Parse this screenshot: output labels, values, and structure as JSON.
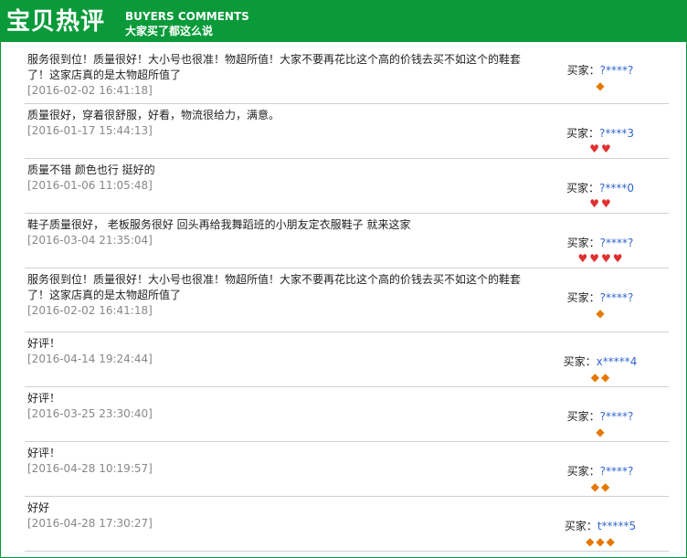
{
  "header": {
    "title": "宝贝热评",
    "subtitle_en": "BUYERS COMMENTS",
    "subtitle_cn": "大家买了都这么说"
  },
  "buyer_label": "买家：",
  "reviews": [
    {
      "text": "服务很到位！质量很好！大小号也很准！物超所值！大家不要再花比这个高的价钱去买不如这个的鞋套了！这家店真的是太物超所值了",
      "time": "[2016-02-02 16:41:18]",
      "buyer": "?****?",
      "badge": "gem",
      "badge_count": 1
    },
    {
      "text": "质量很好，穿着很舒服，好看，物流很给力，满意。",
      "time": "[2016-01-17 15:44:13]",
      "buyer": "?****3",
      "badge": "heart",
      "badge_count": 2
    },
    {
      "text": "质量不错 颜色也行 挺好的",
      "time": "[2016-01-06 11:05:48]",
      "buyer": "?****0",
      "badge": "heart",
      "badge_count": 2
    },
    {
      "text": "鞋子质量很好， 老板服务很好 回头再给我舞蹈班的小朋友定衣服鞋子 就来这家",
      "time": "[2016-03-04 21:35:04]",
      "buyer": "?****?",
      "badge": "heart",
      "badge_count": 4
    },
    {
      "text": "服务很到位！质量很好！大小号也很准！物超所值！大家不要再花比这个高的价钱去买不如这个的鞋套了！这家店真的是太物超所值了",
      "time": "[2016-02-02 16:41:18]",
      "buyer": "?****?",
      "badge": "gem",
      "badge_count": 1
    },
    {
      "text": "好评！",
      "time": "[2016-04-14 19:24:44]",
      "buyer": "x*****4",
      "badge": "gem",
      "badge_count": 2
    },
    {
      "text": "好评！",
      "time": "[2016-03-25 23:30:40]",
      "buyer": "?****?",
      "badge": "gem",
      "badge_count": 1
    },
    {
      "text": "好评！",
      "time": "[2016-04-28 10:19:57]",
      "buyer": "?****?",
      "badge": "gem",
      "badge_count": 2
    },
    {
      "text": "好好",
      "time": "[2016-04-28 17:30:27]",
      "buyer": "t*****5",
      "badge": "gem",
      "badge_count": 3
    }
  ]
}
